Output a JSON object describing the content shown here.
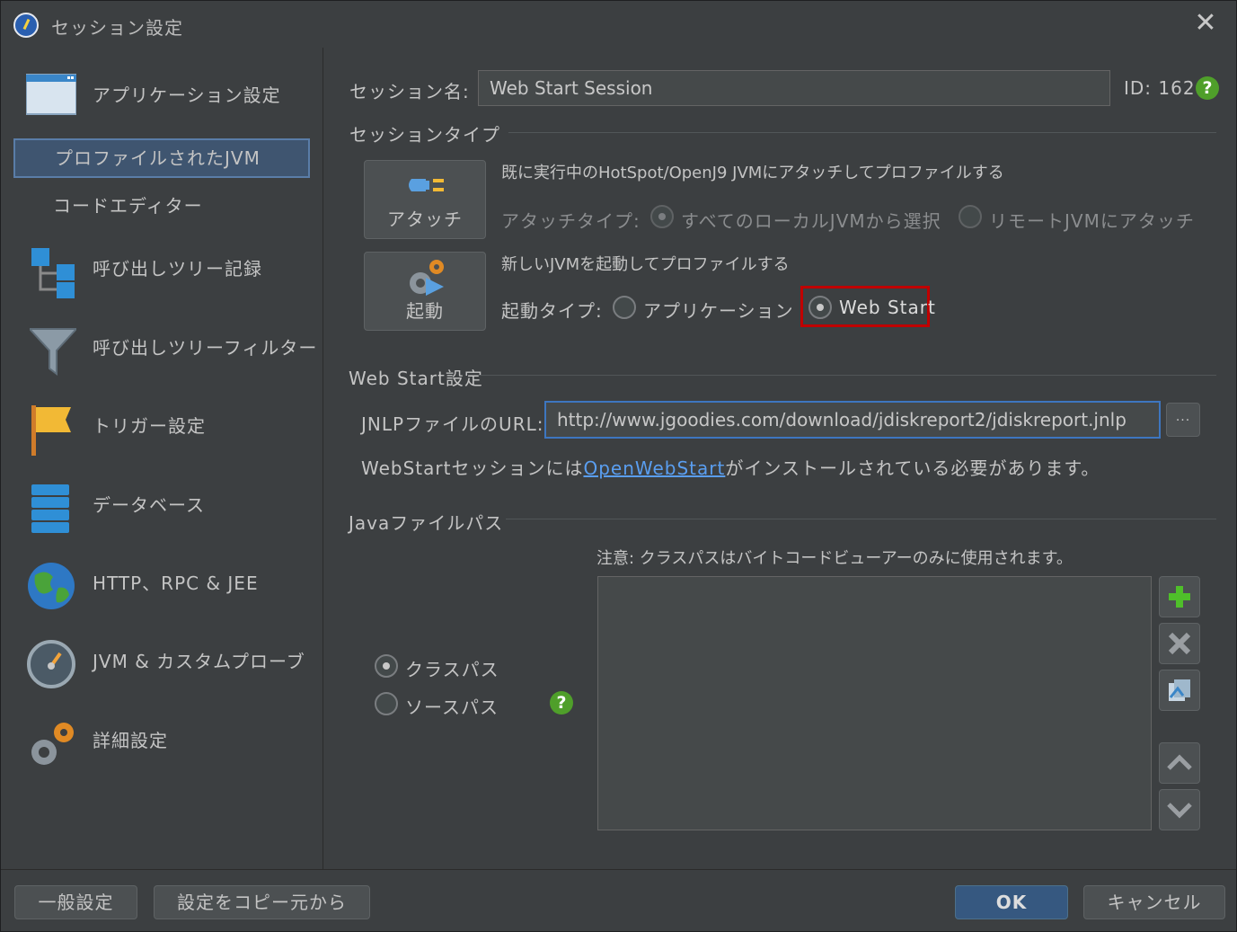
{
  "window": {
    "title": "セッション設定",
    "close_icon": "close-icon"
  },
  "sidebar": {
    "items": [
      {
        "label": "アプリケーション設定",
        "icon": "window-icon"
      },
      {
        "label": "プロファイルされたJVM",
        "selected": true
      },
      {
        "label": "コードエディター"
      },
      {
        "label": "呼び出しツリー記録",
        "icon": "call-tree-icon"
      },
      {
        "label": "呼び出しツリーフィルター",
        "icon": "funnel-icon"
      },
      {
        "label": "トリガー設定",
        "icon": "flag-icon"
      },
      {
        "label": "データベース",
        "icon": "database-icon"
      },
      {
        "label": "HTTP、RPC & JEE",
        "icon": "globe-icon"
      },
      {
        "label": "JVM & カスタムプローブ",
        "icon": "gauge-icon"
      },
      {
        "label": "詳細設定",
        "icon": "gears-icon"
      }
    ]
  },
  "session": {
    "name_label": "セッション名:",
    "name_value": "Web Start Session",
    "id_label": "ID: 162"
  },
  "session_type": {
    "section_label": "セッションタイプ",
    "attach_button": "アタッチ",
    "attach_desc": "既に実行中のHotSpot/OpenJ9 JVMにアタッチしてプロファイルする",
    "attach_type_label": "アタッチタイプ:",
    "attach_opt_local": "すべてのローカルJVMから選択",
    "attach_opt_remote": "リモートJVMにアタッチ",
    "launch_button": "起動",
    "launch_desc": "新しいJVMを起動してプロファイルする",
    "launch_type_label": "起動タイプ:",
    "launch_opt_app": "アプリケーション",
    "launch_opt_webstart": "Web Start"
  },
  "webstart": {
    "section_label": "Web Start設定",
    "url_label": "JNLPファイルのURL:",
    "url_value": "http://www.jgoodies.com/download/jdiskreport2/jdiskreport.jnlp",
    "browse_label": "...",
    "note_before": "WebStartセッションには",
    "note_link": "OpenWebStart",
    "note_after": "がインストールされている必要があります。"
  },
  "java_path": {
    "section_label": "Javaファイルパス",
    "note": "注意: クラスパスはバイトコードビューアーのみに使用されます。",
    "opt_classpath": "クラスパス",
    "opt_sourcepath": "ソースパス",
    "buttons": [
      "add-icon",
      "remove-icon",
      "copy-icon",
      "move-up-icon",
      "move-down-icon"
    ]
  },
  "footer": {
    "general_settings": "一般設定",
    "copy_settings": "設定をコピー元から",
    "ok": "OK",
    "cancel": "キャンセル"
  },
  "colors": {
    "background": "#3c3f41",
    "selection": "#3f5570",
    "accent": "#365880",
    "help": "#4f9f2a",
    "highlight": "#c00000",
    "link": "#5a9ef0"
  }
}
